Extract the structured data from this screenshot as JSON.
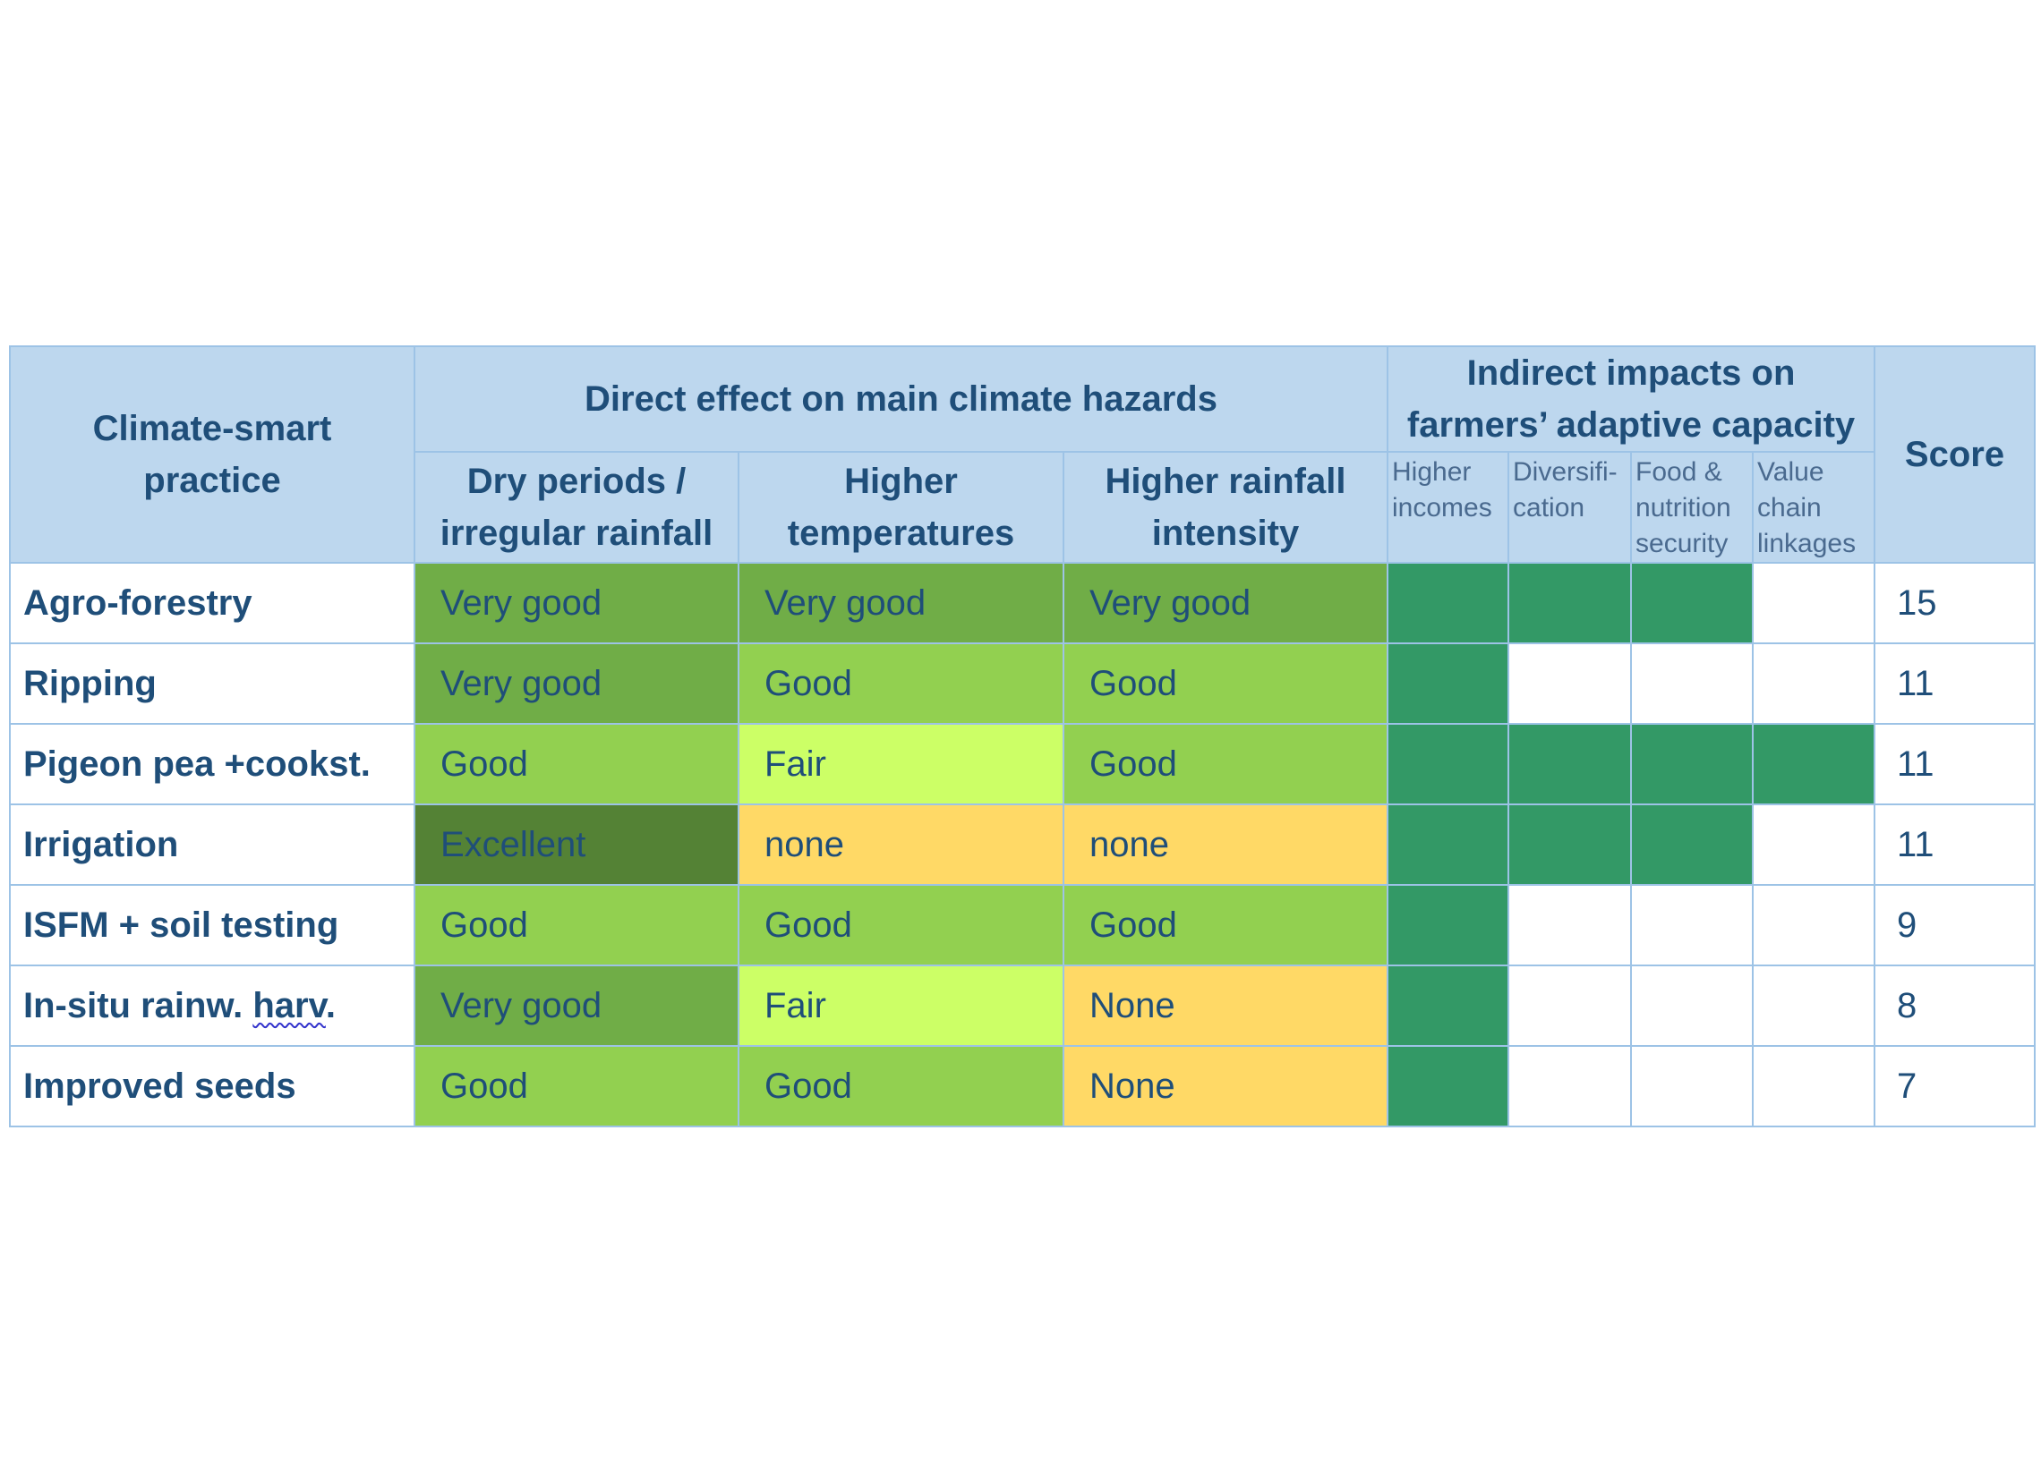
{
  "table": {
    "header": {
      "practice": "Climate-smart practice",
      "direct_group": "Direct effect on main climate hazards",
      "indirect_group": "Indirect impacts on farmers’ adaptive capacity",
      "score": "Score",
      "direct_columns": [
        "Dry periods / irregular rainfall",
        "Higher temperatures",
        "Higher rainfall intensity"
      ],
      "indirect_columns": [
        "Higher incomes",
        "Diversifi-cation",
        "Food & nutrition security",
        "Value chain linkages"
      ]
    },
    "rows": [
      {
        "practice": "Agro-forestry",
        "direct": [
          "Very good",
          "Very good",
          "Very good"
        ],
        "indirect": [
          true,
          true,
          true,
          false
        ],
        "score": "15"
      },
      {
        "practice": "Ripping",
        "direct": [
          "Very good",
          "Good",
          "Good"
        ],
        "indirect": [
          true,
          false,
          false,
          false
        ],
        "score": "11"
      },
      {
        "practice": "Pigeon pea +cookst.",
        "direct": [
          "Good",
          "Fair",
          "Good"
        ],
        "indirect": [
          true,
          true,
          true,
          true
        ],
        "score": "11"
      },
      {
        "practice": "Irrigation",
        "direct": [
          "Excellent",
          "none",
          "none"
        ],
        "indirect": [
          true,
          true,
          true,
          false
        ],
        "score": "11"
      },
      {
        "practice": "ISFM + soil testing",
        "direct": [
          "Good",
          "Good",
          "Good"
        ],
        "indirect": [
          true,
          false,
          false,
          false
        ],
        "score": "9"
      },
      {
        "practice_main": "In-situ rainw. ",
        "practice_flagged": "harv",
        "practice_tail": ".",
        "direct": [
          "Very good",
          "Fair",
          "None"
        ],
        "indirect": [
          true,
          false,
          false,
          false
        ],
        "score": "8"
      },
      {
        "practice": "Improved seeds",
        "direct": [
          "Good",
          "Good",
          "None"
        ],
        "indirect": [
          true,
          false,
          false,
          false
        ],
        "score": "7"
      }
    ],
    "rating_colors": {
      "Excellent": "#548235",
      "Very good": "#70AD47",
      "Good": "#92D050",
      "Fair": "#CCFF66",
      "None": "#FFD966",
      "none": "#FFD966"
    },
    "indirect_color": "#339966",
    "header_color": "#BDD7EE"
  }
}
